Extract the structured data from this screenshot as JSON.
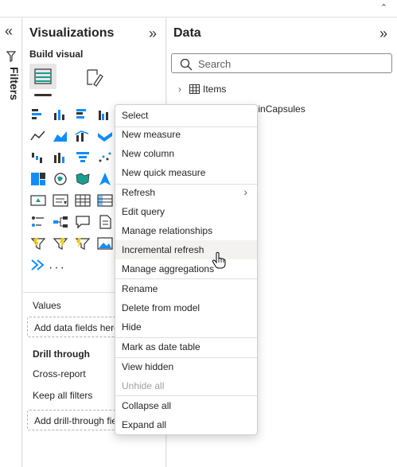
{
  "top_bar": {
    "chevron_icon": "chevron-up-icon"
  },
  "filters_pane": {
    "label": "Filters",
    "expand_icon": "double-chevron-left-icon",
    "filter_icon": "funnel-icon"
  },
  "visualizations_pane": {
    "title": "Visualizations",
    "collapse_icon": "double-chevron-right-icon",
    "build_visual_label": "Build visual",
    "more_visuals": "···",
    "values_label": "Values",
    "values_placeholder": "Add data fields here",
    "drill_through_label": "Drill through",
    "cross_report_label": "Cross-report",
    "keep_all_filters_label": "Keep all filters",
    "drill_through_placeholder": "Add drill-through fields here"
  },
  "data_pane": {
    "title": "Data",
    "collapse_icon": "double-chevron-right-icon",
    "search_placeholder": "Search",
    "tree": [
      {
        "label": "Items"
      },
      {
        "label": "IntervalsWithinCapsules"
      }
    ]
  },
  "context_menu": {
    "items": [
      {
        "label": "Select"
      },
      {
        "label": "New measure"
      },
      {
        "label": "New column"
      },
      {
        "label": "New quick measure"
      },
      {
        "label": "Refresh"
      },
      {
        "label": "Edit query"
      },
      {
        "label": "Manage relationships"
      },
      {
        "label": "Incremental refresh"
      },
      {
        "label": "Manage aggregations"
      },
      {
        "label": "Rename"
      },
      {
        "label": "Delete from model"
      },
      {
        "label": "Hide"
      },
      {
        "label": "Mark as date table"
      },
      {
        "label": "View hidden"
      },
      {
        "label": "Unhide all"
      },
      {
        "label": "Collapse all"
      },
      {
        "label": "Expand all"
      }
    ]
  },
  "colors": {
    "accent_blue": "#118dff",
    "yellow": "#f2c811",
    "teal": "#1a9e8f"
  }
}
